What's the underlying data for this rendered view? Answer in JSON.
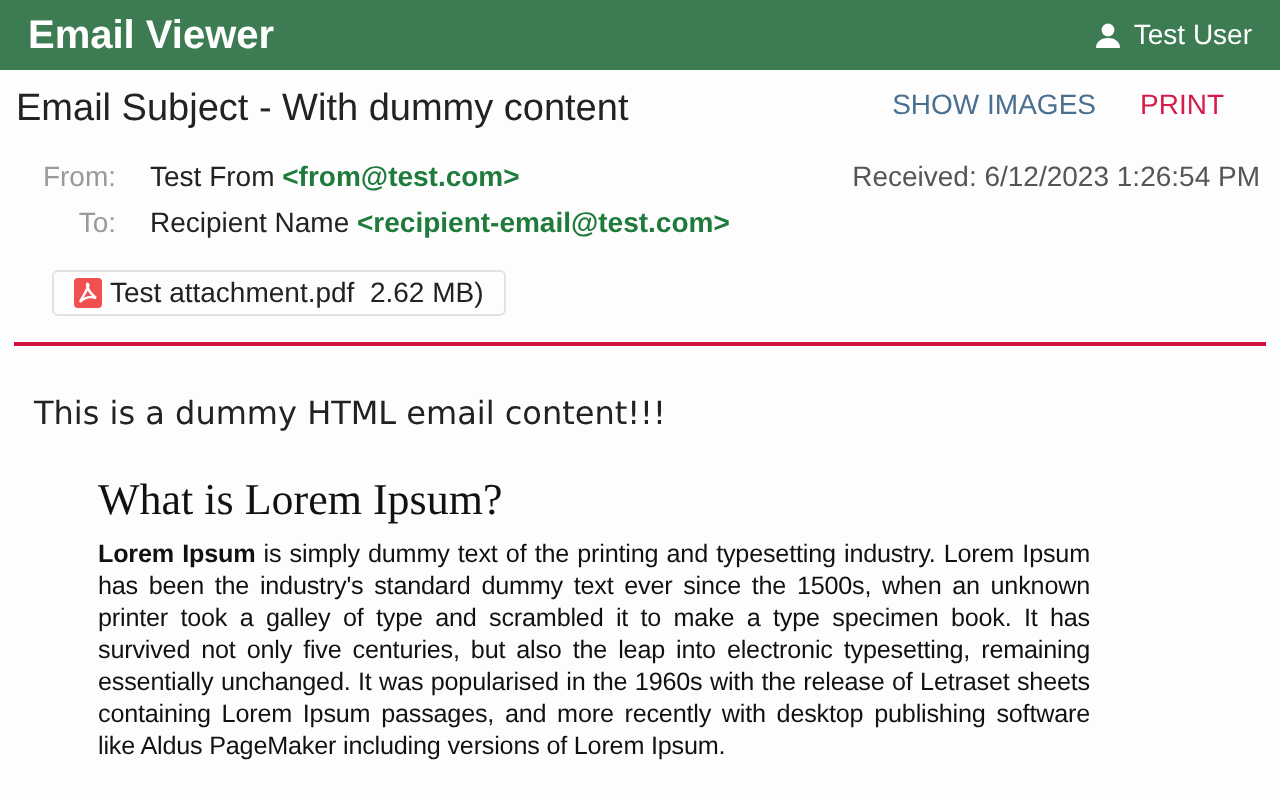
{
  "header": {
    "title": "Email Viewer",
    "user": "Test User"
  },
  "email": {
    "subject": "Email Subject - With dummy content",
    "actions": [
      "SHOW IMAGES",
      "PRINT"
    ],
    "from": {
      "label": "From:",
      "name": "Test From",
      "address": "<from@test.com>"
    },
    "received": "Received: 6/12/2023 1:26:54 PM",
    "to": {
      "label": "To:",
      "name": "Recipient Name",
      "address": "<recipient-email@test.com>"
    },
    "attachments": [
      {
        "label": "Test attachment.pdf  2.62 MB)"
      }
    ]
  },
  "body": {
    "intro": "This is a dummy HTML email content!!!",
    "heading": "What is Lorem Ipsum?",
    "paragraph": "**Lorem Ipsum** is simply dummy text of the printing and typesetting industry. Lorem Ipsum has been the industry's standard dummy text ever since the 1500s, when an unknown printer took a galley of type and scrambled it to make a type specimen book. It has survived not only five centuries, but also the leap into electronic typesetting, remaining essentially unchanged. It was popularised in the 1960s with the release of Letraset sheets containing Lorem Ipsum passages, and more recently with desktop publishing software like Aldus PageMaker including versions of Lorem Ipsum."
  }
}
